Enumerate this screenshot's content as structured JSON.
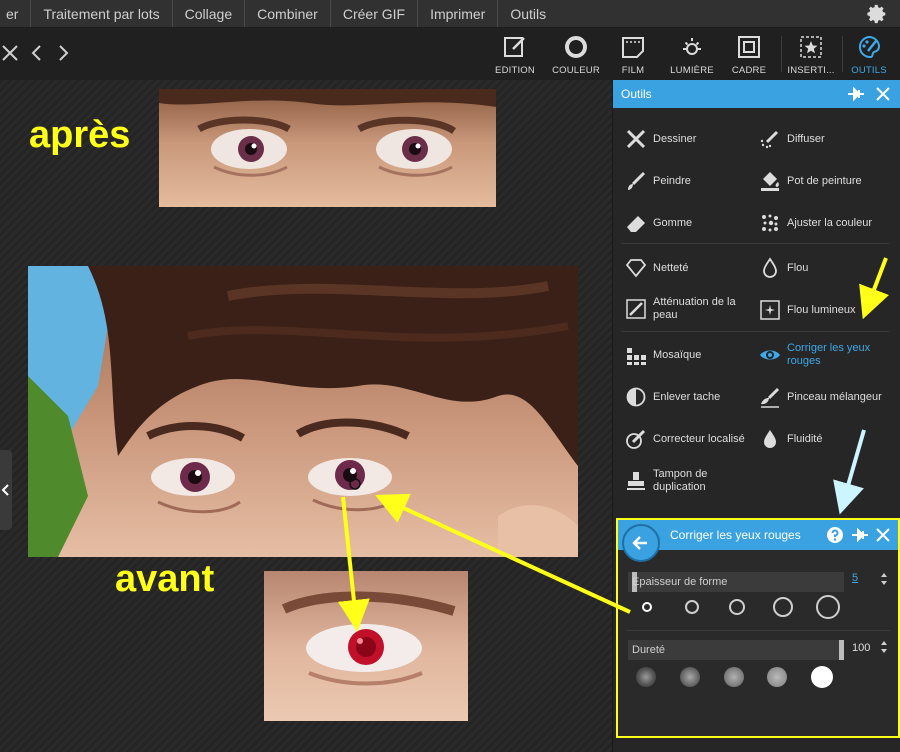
{
  "menu": {
    "items": [
      "er",
      "Traitement par lots",
      "Collage",
      "Combiner",
      "Créer GIF",
      "Imprimer",
      "Outils"
    ]
  },
  "toolbar": {
    "tabs": [
      "EDITION",
      "COULEUR",
      "FILM",
      "LUMIÈRE",
      "CADRE",
      "INSERTI...",
      "OUTILS"
    ],
    "active_tab": "OUTILS"
  },
  "canvas": {
    "caption_after": "après",
    "caption_before": "avant"
  },
  "panel": {
    "title": "Outils",
    "tools": [
      {
        "label": "Dessiner",
        "icon": "pencil-cross-icon"
      },
      {
        "label": "Diffuser",
        "icon": "spray-icon"
      },
      {
        "label": "Peindre",
        "icon": "brush-icon"
      },
      {
        "label": "Pot de peinture",
        "icon": "paint-bucket-icon"
      },
      {
        "label": "Gomme",
        "icon": "eraser-icon"
      },
      {
        "label": "Ajuster la couleur",
        "icon": "sparkle-dots-icon"
      },
      {
        "label": "Netteté",
        "icon": "diamond-icon"
      },
      {
        "label": "Flou",
        "icon": "drop-icon"
      },
      {
        "label": "Atténuation de la peau",
        "icon": "skin-smooth-icon"
      },
      {
        "label": "Flou lumineux",
        "icon": "glow-blur-icon"
      },
      {
        "label": "Mosaïque",
        "icon": "mosaic-icon"
      },
      {
        "label": "Corriger les yeux rouges",
        "icon": "eye-icon"
      },
      {
        "label": "Enlever tache",
        "icon": "half-circle-icon"
      },
      {
        "label": "Pinceau mélangeur",
        "icon": "mixer-brush-icon"
      },
      {
        "label": "Correcteur localisé",
        "icon": "spot-healing-icon"
      },
      {
        "label": "Fluidité",
        "icon": "fluid-drop-icon"
      },
      {
        "label": "Tampon de duplication",
        "icon": "stamp-icon"
      }
    ],
    "selected_tool": "Corriger les yeux rouges"
  },
  "subpanel": {
    "title": "Corriger les yeux rouges",
    "shape_label": "Epaisseur de forme",
    "shape_value": "5",
    "hardness_label": "Dureté",
    "hardness_value": "100",
    "shape_level": 0.02,
    "hardness_level": 1.0
  },
  "colors": {
    "accent": "#3aa2e0",
    "annotation": "#ffff1a",
    "annotation_cyan": "#ccf6ff"
  }
}
